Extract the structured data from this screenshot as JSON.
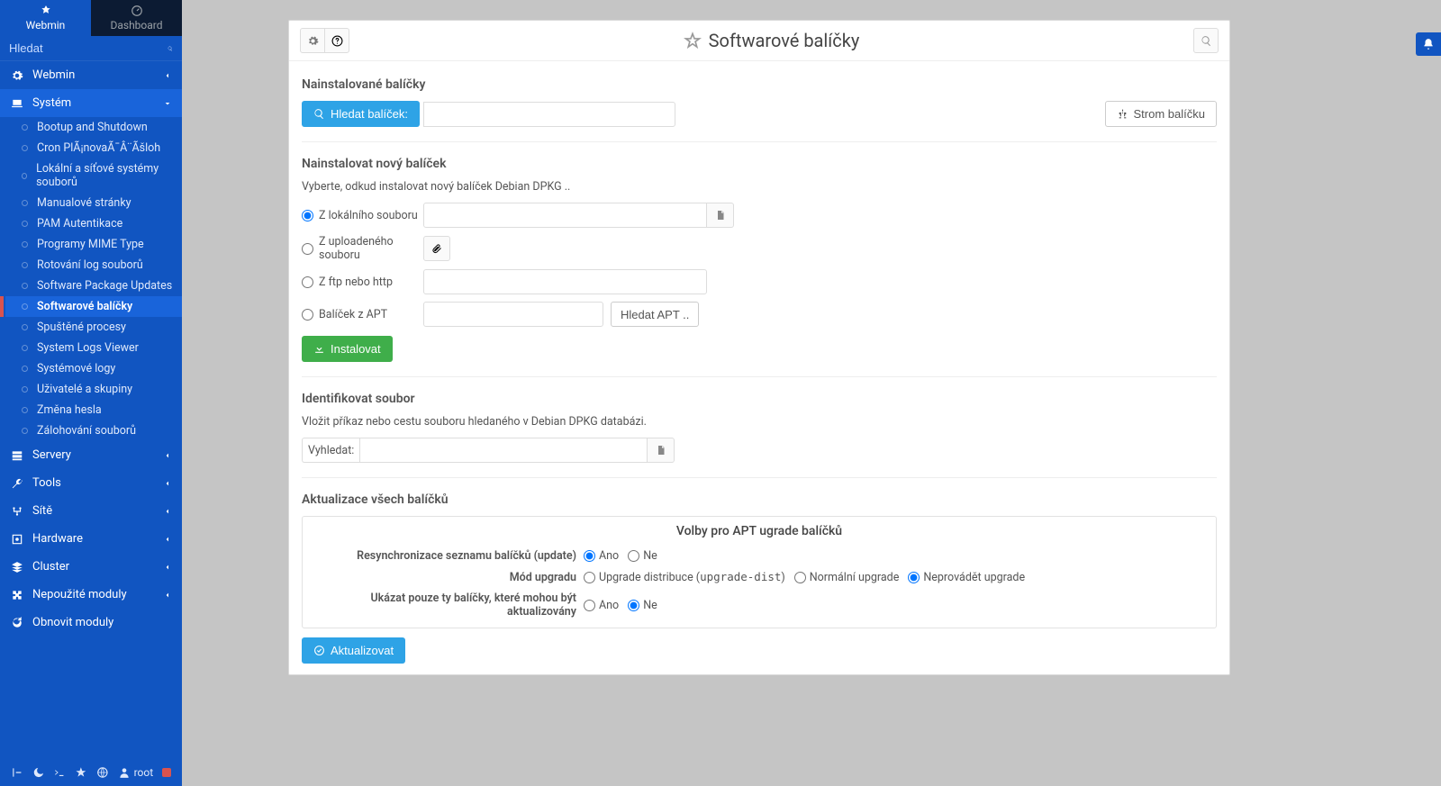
{
  "sidebar": {
    "tabs": {
      "webmin": "Webmin",
      "dashboard": "Dashboard"
    },
    "search_placeholder": "Hledat",
    "sections": {
      "webmin": "Webmin",
      "system": "Systém",
      "servers": "Servery",
      "tools": "Tools",
      "site": "Sítě",
      "hardware": "Hardware",
      "cluster": "Cluster",
      "unused": "Nepoužité moduly",
      "refresh": "Obnovit moduly"
    },
    "system_items": [
      "Bootup and Shutdown",
      "Cron PlÃ¡novaÃ¯Â¨Ãšloh",
      "Lokální a síťové systémy souborů",
      "Manualové stránky",
      "PAM Autentikace",
      "Programy MIME Type",
      "Rotování log souborů",
      "Software Package Updates",
      "Softwarové balíčky",
      "Spuštěné procesy",
      "System Logs Viewer",
      "Systémové logy",
      "Uživatelé a skupiny",
      "Změna hesla",
      "Zálohování souborů"
    ],
    "active_system_item": 8,
    "footer_user": "root"
  },
  "main": {
    "title": "Softwarové balíčky",
    "installed": {
      "title": "Nainstalované balíčky",
      "search_btn": "Hledat balíček:",
      "tree_btn": "Strom balíčku"
    },
    "install": {
      "title": "Nainstalovat nový balíček",
      "subtext": "Vyberte, odkud instalovat nový balíček Debian DPKG ..",
      "opt_local": "Z lokálního souboru",
      "opt_upload": "Z uploadeného souboru",
      "opt_ftp": "Z ftp nebo http",
      "opt_apt": "Balíček z APT",
      "apt_search_btn": "Hledat APT ..",
      "install_btn": "Instalovat"
    },
    "identify": {
      "title": "Identifikovat soubor",
      "subtext": "Vložit příkaz nebo cestu souboru hledaného v Debian DPKG databázi.",
      "label": "Vyhledat:"
    },
    "update": {
      "title": "Aktualizace všech balíčků",
      "box_title": "Volby pro APT ugrade balíčků",
      "r1_key": "Resynchronizace seznamu balíčků (update)",
      "yes": "Ano",
      "no": "Ne",
      "r2_key": "Mód upgradu",
      "r2_opt1a": "Upgrade distribuce (",
      "r2_opt1b": "upgrade-dist",
      "r2_opt1c": ")",
      "r2_opt2": "Normální upgrade",
      "r2_opt3": "Neprovádět upgrade",
      "r3_key": "Ukázat pouze ty balíčky, které mohou být aktualizovány",
      "update_btn": "Aktualizovat"
    }
  }
}
